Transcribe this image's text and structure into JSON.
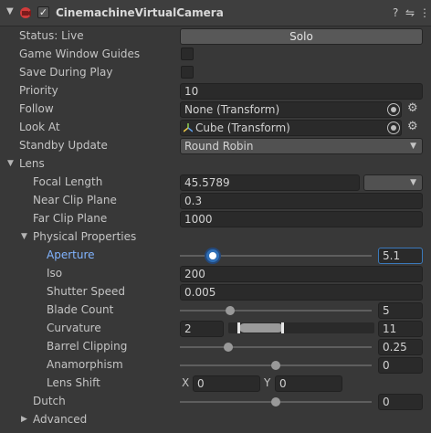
{
  "header": {
    "title": "CinemachineVirtualCamera",
    "enabled_checkmark": "✓",
    "help_icon": "?",
    "preset_icon": "⇋",
    "menu_icon": "⋮",
    "foldout_icon": "▼"
  },
  "status": {
    "label": "Status: Live",
    "solo_button": "Solo"
  },
  "game_window_guides": {
    "label": "Game Window Guides"
  },
  "save_during_play": {
    "label": "Save During Play"
  },
  "priority": {
    "label": "Priority",
    "value": "10"
  },
  "follow": {
    "label": "Follow",
    "value": "None (Transform)"
  },
  "look_at": {
    "label": "Look At",
    "value": "Cube (Transform)"
  },
  "standby_update": {
    "label": "Standby Update",
    "value": "Round Robin"
  },
  "lens": {
    "label": "Lens",
    "focal_length": {
      "label": "Focal Length",
      "value": "45.5789"
    },
    "near_clip_plane": {
      "label": "Near Clip Plane",
      "value": "0.3"
    },
    "far_clip_plane": {
      "label": "Far Clip Plane",
      "value": "1000"
    },
    "physical_properties": {
      "label": "Physical Properties",
      "aperture": {
        "label": "Aperture",
        "value": "5.1",
        "slider_fraction": 0.17
      },
      "iso": {
        "label": "Iso",
        "value": "200"
      },
      "shutter_speed": {
        "label": "Shutter Speed",
        "value": "0.005"
      },
      "blade_count": {
        "label": "Blade Count",
        "value": "5",
        "slider_fraction": 0.26
      },
      "curvature": {
        "label": "Curvature",
        "min": "2",
        "max": "11"
      },
      "barrel_clipping": {
        "label": "Barrel Clipping",
        "value": "0.25",
        "slider_fraction": 0.25
      },
      "anamorphism": {
        "label": "Anamorphism",
        "value": "0",
        "slider_fraction": 0.5
      },
      "lens_shift": {
        "label": "Lens Shift",
        "x_label": "X",
        "x_value": "0",
        "y_label": "Y",
        "y_value": "0"
      }
    },
    "dutch": {
      "label": "Dutch",
      "value": "0",
      "slider_fraction": 0.5
    },
    "advanced": {
      "label": "Advanced"
    }
  }
}
